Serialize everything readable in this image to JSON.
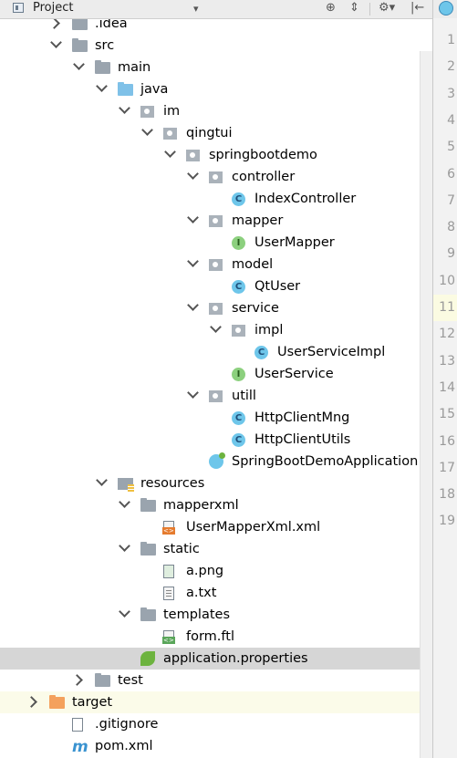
{
  "toolbar": {
    "title": "Project",
    "dropdown_glyph": "▾",
    "target_glyph": "⊕",
    "collapse_glyph": "⇕",
    "settings_glyph": "⚙▾",
    "hide_glyph": "|←"
  },
  "tree": [
    {
      "label": ".idea",
      "depth": 1,
      "expanded": false,
      "icon": "folder-gray-icon"
    },
    {
      "label": "src",
      "depth": 1,
      "expanded": true,
      "icon": "folder-gray-icon"
    },
    {
      "label": "main",
      "depth": 2,
      "expanded": true,
      "icon": "folder-gray-icon"
    },
    {
      "label": "java",
      "depth": 3,
      "expanded": true,
      "icon": "folder-blue-icon"
    },
    {
      "label": "im",
      "depth": 4,
      "expanded": true,
      "icon": "package-icon"
    },
    {
      "label": "qingtui",
      "depth": 5,
      "expanded": true,
      "icon": "package-icon"
    },
    {
      "label": "springbootdemo",
      "depth": 6,
      "expanded": true,
      "icon": "package-icon"
    },
    {
      "label": "controller",
      "depth": 7,
      "expanded": true,
      "icon": "package-icon"
    },
    {
      "label": "IndexController",
      "depth": 8,
      "icon": "class-icon"
    },
    {
      "label": "mapper",
      "depth": 7,
      "expanded": true,
      "icon": "package-icon"
    },
    {
      "label": "UserMapper",
      "depth": 8,
      "icon": "interface-icon"
    },
    {
      "label": "model",
      "depth": 7,
      "expanded": true,
      "icon": "package-icon"
    },
    {
      "label": "QtUser",
      "depth": 8,
      "icon": "class-icon"
    },
    {
      "label": "service",
      "depth": 7,
      "expanded": true,
      "icon": "package-icon"
    },
    {
      "label": "impl",
      "depth": 8,
      "expanded": true,
      "icon": "package-icon"
    },
    {
      "label": "UserServiceImpl",
      "depth": 9,
      "icon": "class-icon"
    },
    {
      "label": "UserService",
      "depth": 8,
      "icon": "interface-icon"
    },
    {
      "label": "utill",
      "depth": 7,
      "expanded": true,
      "icon": "package-icon"
    },
    {
      "label": "HttpClientMng",
      "depth": 8,
      "icon": "class-icon"
    },
    {
      "label": "HttpClientUtils",
      "depth": 8,
      "icon": "class-icon"
    },
    {
      "label": "SpringBootDemoApplication",
      "depth": 7,
      "icon": "spring-boot-class-icon"
    },
    {
      "label": "resources",
      "depth": 3,
      "expanded": true,
      "icon": "resources-folder-icon"
    },
    {
      "label": "mapperxml",
      "depth": 4,
      "expanded": true,
      "icon": "folder-gray-icon"
    },
    {
      "label": "UserMapperXml.xml",
      "depth": 5,
      "icon": "xml-file-icon"
    },
    {
      "label": "static",
      "depth": 4,
      "expanded": true,
      "icon": "folder-gray-icon"
    },
    {
      "label": "a.png",
      "depth": 5,
      "icon": "image-file-icon"
    },
    {
      "label": "a.txt",
      "depth": 5,
      "icon": "text-file-icon"
    },
    {
      "label": "templates",
      "depth": 4,
      "expanded": true,
      "icon": "folder-gray-icon"
    },
    {
      "label": "form.ftl",
      "depth": 5,
      "icon": "ftl-file-icon"
    },
    {
      "label": "application.properties",
      "depth": 4,
      "icon": "properties-file-icon",
      "selected": true
    },
    {
      "label": "test",
      "depth": 2,
      "expanded": false,
      "icon": "folder-gray-icon"
    },
    {
      "label": "target",
      "depth": 0,
      "expanded": false,
      "icon": "folder-orange-icon",
      "highlighted": true
    },
    {
      "label": ".gitignore",
      "depth": 1,
      "icon": "gitignore-file-icon"
    },
    {
      "label": "pom.xml",
      "depth": 1,
      "icon": "maven-icon"
    }
  ],
  "line_numbers": [
    "1",
    "2",
    "3",
    "4",
    "5",
    "6",
    "7",
    "8",
    "9",
    "10",
    "11",
    "12",
    "13",
    "14",
    "15",
    "16",
    "17",
    "18",
    "19"
  ],
  "current_line": "11",
  "colors": {
    "selected_row": "#d6d6d6",
    "highlight_row": "#fbfbe9",
    "class_badge": "#6ec6ea",
    "interface_badge": "#8cd07e",
    "source_folder": "#7fc1e8",
    "excluded_folder": "#f4a15d"
  }
}
